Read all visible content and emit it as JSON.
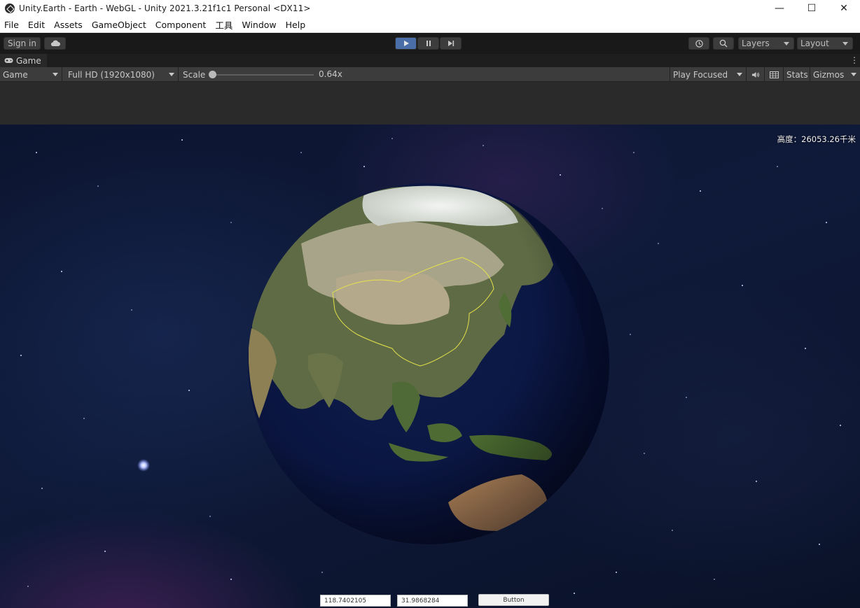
{
  "window": {
    "title": "Unity.Earth - Earth - WebGL - Unity 2021.3.21f1c1 Personal <DX11>",
    "minimize_glyph": "—",
    "maximize_glyph": "☐",
    "close_glyph": "✕"
  },
  "menu": {
    "items": [
      "File",
      "Edit",
      "Assets",
      "GameObject",
      "Component",
      "工具",
      "Window",
      "Help"
    ]
  },
  "toolbar": {
    "sign_in": "Sign in",
    "layers": "Layers",
    "layout": "Layout",
    "play_state": "playing"
  },
  "tab": {
    "label": "Game",
    "icon": "gamepad-icon"
  },
  "game_toolbar": {
    "display": "Game",
    "resolution": "Full HD (1920x1080)",
    "scale_label": "Scale",
    "scale_value": "0.64x",
    "play_mode": "Play Focused",
    "stats": "Stats",
    "gizmos": "Gizmos"
  },
  "viewport": {
    "height_readout": "高度：26053.26千米",
    "longitude_value": "118.7402105",
    "latitude_value": "31.9868284",
    "button_label": "Button"
  },
  "colors": {
    "play_active": "#4a6fa8",
    "editor_bg": "#282828",
    "space_bg": "#0f1a3a",
    "border_outline": "#e6e24a"
  }
}
